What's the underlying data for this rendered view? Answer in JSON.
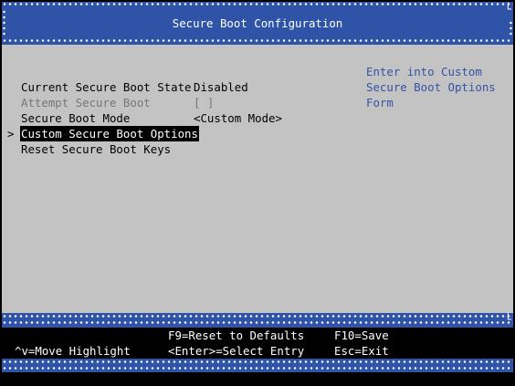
{
  "title": "Secure Boot Configuration",
  "selector": ">",
  "menu": [
    {
      "label": "Current Secure Boot State",
      "value": "Disabled",
      "state": "normal"
    },
    {
      "label": "Attempt Secure Boot",
      "value": "[ ]",
      "state": "disabled"
    },
    {
      "label": "Secure Boot Mode",
      "value": "<Custom Mode>",
      "state": "normal"
    },
    {
      "label": "Custom Secure Boot Options",
      "value": "",
      "state": "selected"
    },
    {
      "label": "Reset Secure Boot Keys",
      "value": "",
      "state": "normal"
    }
  ],
  "help": [
    "Enter into Custom",
    "Secure Boot Options",
    "Form"
  ],
  "footer": {
    "f9": "F9=Reset to Defaults",
    "f10": "F10=Save",
    "move": "^v=Move Highlight",
    "enter": "<Enter>=Select Entry",
    "esc": "Esc=Exit"
  },
  "colors": {
    "background": "#c3c3c3",
    "band": "#2f53a7",
    "help_text": "#3453a6",
    "disabled_text": "#767676",
    "highlight_bg": "#000000"
  }
}
